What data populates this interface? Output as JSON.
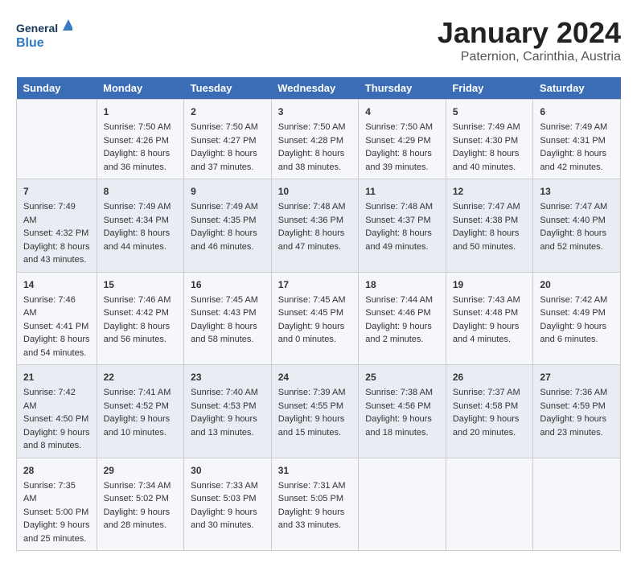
{
  "header": {
    "logo_general": "General",
    "logo_blue": "Blue",
    "month_title": "January 2024",
    "subtitle": "Paternion, Carinthia, Austria"
  },
  "weekdays": [
    "Sunday",
    "Monday",
    "Tuesday",
    "Wednesday",
    "Thursday",
    "Friday",
    "Saturday"
  ],
  "weeks": [
    [
      {
        "day": "",
        "sunrise": "",
        "sunset": "",
        "daylight": ""
      },
      {
        "day": "1",
        "sunrise": "Sunrise: 7:50 AM",
        "sunset": "Sunset: 4:26 PM",
        "daylight": "Daylight: 8 hours and 36 minutes."
      },
      {
        "day": "2",
        "sunrise": "Sunrise: 7:50 AM",
        "sunset": "Sunset: 4:27 PM",
        "daylight": "Daylight: 8 hours and 37 minutes."
      },
      {
        "day": "3",
        "sunrise": "Sunrise: 7:50 AM",
        "sunset": "Sunset: 4:28 PM",
        "daylight": "Daylight: 8 hours and 38 minutes."
      },
      {
        "day": "4",
        "sunrise": "Sunrise: 7:50 AM",
        "sunset": "Sunset: 4:29 PM",
        "daylight": "Daylight: 8 hours and 39 minutes."
      },
      {
        "day": "5",
        "sunrise": "Sunrise: 7:49 AM",
        "sunset": "Sunset: 4:30 PM",
        "daylight": "Daylight: 8 hours and 40 minutes."
      },
      {
        "day": "6",
        "sunrise": "Sunrise: 7:49 AM",
        "sunset": "Sunset: 4:31 PM",
        "daylight": "Daylight: 8 hours and 42 minutes."
      }
    ],
    [
      {
        "day": "7",
        "sunrise": "Sunrise: 7:49 AM",
        "sunset": "Sunset: 4:32 PM",
        "daylight": "Daylight: 8 hours and 43 minutes."
      },
      {
        "day": "8",
        "sunrise": "Sunrise: 7:49 AM",
        "sunset": "Sunset: 4:34 PM",
        "daylight": "Daylight: 8 hours and 44 minutes."
      },
      {
        "day": "9",
        "sunrise": "Sunrise: 7:49 AM",
        "sunset": "Sunset: 4:35 PM",
        "daylight": "Daylight: 8 hours and 46 minutes."
      },
      {
        "day": "10",
        "sunrise": "Sunrise: 7:48 AM",
        "sunset": "Sunset: 4:36 PM",
        "daylight": "Daylight: 8 hours and 47 minutes."
      },
      {
        "day": "11",
        "sunrise": "Sunrise: 7:48 AM",
        "sunset": "Sunset: 4:37 PM",
        "daylight": "Daylight: 8 hours and 49 minutes."
      },
      {
        "day": "12",
        "sunrise": "Sunrise: 7:47 AM",
        "sunset": "Sunset: 4:38 PM",
        "daylight": "Daylight: 8 hours and 50 minutes."
      },
      {
        "day": "13",
        "sunrise": "Sunrise: 7:47 AM",
        "sunset": "Sunset: 4:40 PM",
        "daylight": "Daylight: 8 hours and 52 minutes."
      }
    ],
    [
      {
        "day": "14",
        "sunrise": "Sunrise: 7:46 AM",
        "sunset": "Sunset: 4:41 PM",
        "daylight": "Daylight: 8 hours and 54 minutes."
      },
      {
        "day": "15",
        "sunrise": "Sunrise: 7:46 AM",
        "sunset": "Sunset: 4:42 PM",
        "daylight": "Daylight: 8 hours and 56 minutes."
      },
      {
        "day": "16",
        "sunrise": "Sunrise: 7:45 AM",
        "sunset": "Sunset: 4:43 PM",
        "daylight": "Daylight: 8 hours and 58 minutes."
      },
      {
        "day": "17",
        "sunrise": "Sunrise: 7:45 AM",
        "sunset": "Sunset: 4:45 PM",
        "daylight": "Daylight: 9 hours and 0 minutes."
      },
      {
        "day": "18",
        "sunrise": "Sunrise: 7:44 AM",
        "sunset": "Sunset: 4:46 PM",
        "daylight": "Daylight: 9 hours and 2 minutes."
      },
      {
        "day": "19",
        "sunrise": "Sunrise: 7:43 AM",
        "sunset": "Sunset: 4:48 PM",
        "daylight": "Daylight: 9 hours and 4 minutes."
      },
      {
        "day": "20",
        "sunrise": "Sunrise: 7:42 AM",
        "sunset": "Sunset: 4:49 PM",
        "daylight": "Daylight: 9 hours and 6 minutes."
      }
    ],
    [
      {
        "day": "21",
        "sunrise": "Sunrise: 7:42 AM",
        "sunset": "Sunset: 4:50 PM",
        "daylight": "Daylight: 9 hours and 8 minutes."
      },
      {
        "day": "22",
        "sunrise": "Sunrise: 7:41 AM",
        "sunset": "Sunset: 4:52 PM",
        "daylight": "Daylight: 9 hours and 10 minutes."
      },
      {
        "day": "23",
        "sunrise": "Sunrise: 7:40 AM",
        "sunset": "Sunset: 4:53 PM",
        "daylight": "Daylight: 9 hours and 13 minutes."
      },
      {
        "day": "24",
        "sunrise": "Sunrise: 7:39 AM",
        "sunset": "Sunset: 4:55 PM",
        "daylight": "Daylight: 9 hours and 15 minutes."
      },
      {
        "day": "25",
        "sunrise": "Sunrise: 7:38 AM",
        "sunset": "Sunset: 4:56 PM",
        "daylight": "Daylight: 9 hours and 18 minutes."
      },
      {
        "day": "26",
        "sunrise": "Sunrise: 7:37 AM",
        "sunset": "Sunset: 4:58 PM",
        "daylight": "Daylight: 9 hours and 20 minutes."
      },
      {
        "day": "27",
        "sunrise": "Sunrise: 7:36 AM",
        "sunset": "Sunset: 4:59 PM",
        "daylight": "Daylight: 9 hours and 23 minutes."
      }
    ],
    [
      {
        "day": "28",
        "sunrise": "Sunrise: 7:35 AM",
        "sunset": "Sunset: 5:00 PM",
        "daylight": "Daylight: 9 hours and 25 minutes."
      },
      {
        "day": "29",
        "sunrise": "Sunrise: 7:34 AM",
        "sunset": "Sunset: 5:02 PM",
        "daylight": "Daylight: 9 hours and 28 minutes."
      },
      {
        "day": "30",
        "sunrise": "Sunrise: 7:33 AM",
        "sunset": "Sunset: 5:03 PM",
        "daylight": "Daylight: 9 hours and 30 minutes."
      },
      {
        "day": "31",
        "sunrise": "Sunrise: 7:31 AM",
        "sunset": "Sunset: 5:05 PM",
        "daylight": "Daylight: 9 hours and 33 minutes."
      },
      {
        "day": "",
        "sunrise": "",
        "sunset": "",
        "daylight": ""
      },
      {
        "day": "",
        "sunrise": "",
        "sunset": "",
        "daylight": ""
      },
      {
        "day": "",
        "sunrise": "",
        "sunset": "",
        "daylight": ""
      }
    ]
  ]
}
